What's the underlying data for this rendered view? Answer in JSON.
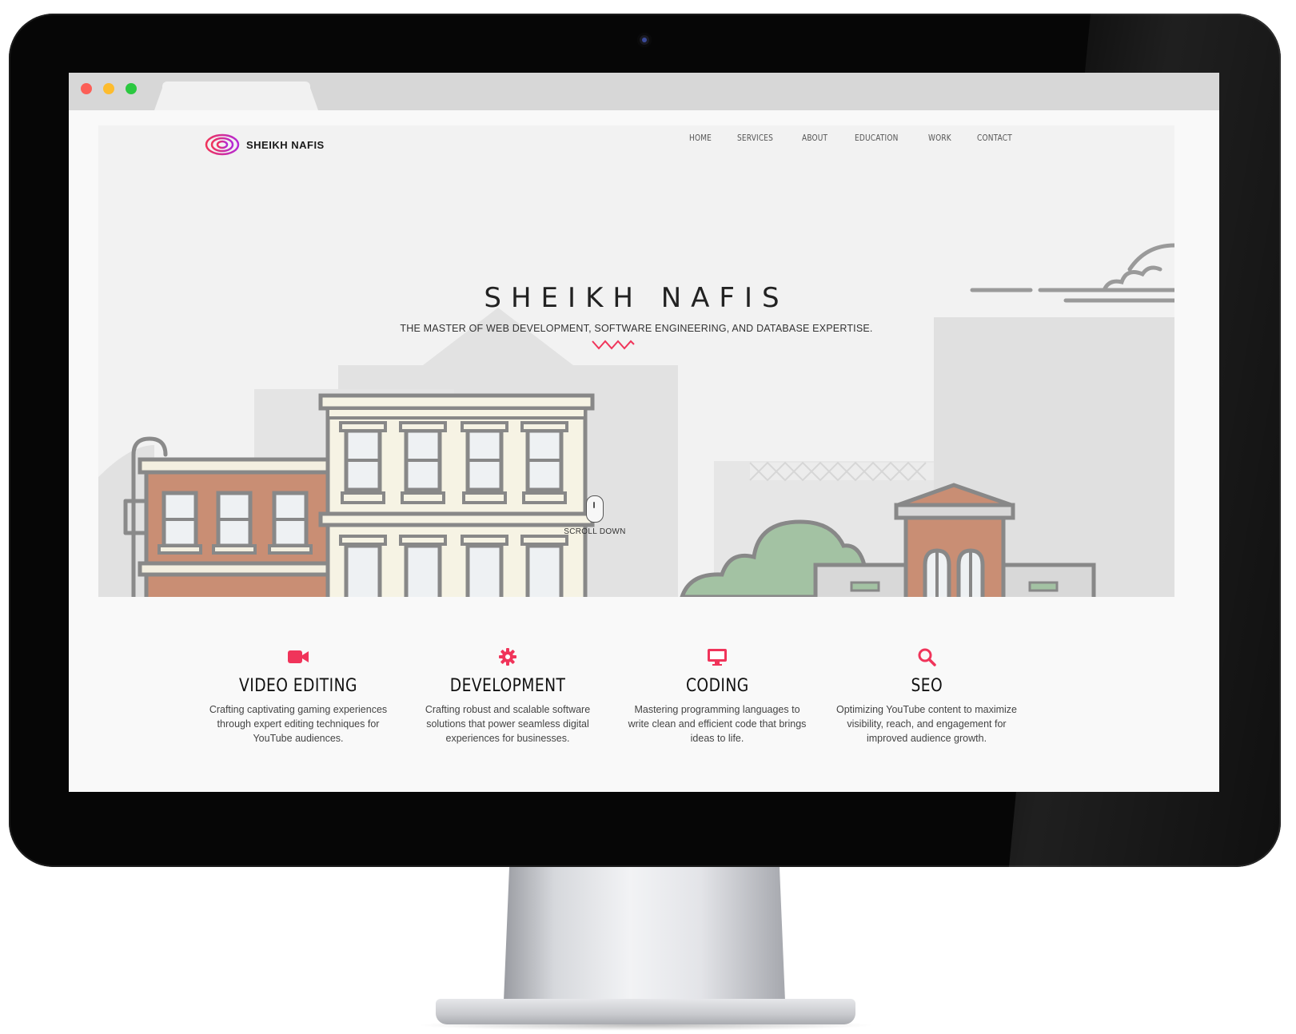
{
  "site": {
    "brand": "SHEIKH NAFIS",
    "nav": [
      "HOME",
      "SERVICES",
      "ABOUT",
      "EDUCATION",
      "WORK",
      "CONTACT"
    ]
  },
  "hero": {
    "title": "SHEIKH NAFIS",
    "subtitle": "THE MASTER OF WEB DEVELOPMENT, SOFTWARE ENGINEERING, AND DATABASE EXPERTISE.",
    "scroll_label": "SCROLL DOWN"
  },
  "services": [
    {
      "icon": "video-camera-icon",
      "title": "VIDEO EDITING",
      "description": "Crafting captivating gaming experiences through expert editing techniques for YouTube audiences."
    },
    {
      "icon": "gear-icon",
      "title": "DEVELOPMENT",
      "description": "Crafting robust and scalable software solutions that power seamless digital experiences for businesses."
    },
    {
      "icon": "monitor-icon",
      "title": "CODING",
      "description": "Mastering programming languages to write clean and efficient code that brings ideas to life."
    },
    {
      "icon": "search-icon",
      "title": "SEO",
      "description": "Optimizing YouTube content to maximize visibility, reach, and engagement for improved audience growth."
    }
  ],
  "colors": {
    "accent": "#f0345a",
    "hero_background": "#f2f2f2",
    "browser_chrome": "#d7d7d7",
    "monitor_bezel": "#060606"
  }
}
